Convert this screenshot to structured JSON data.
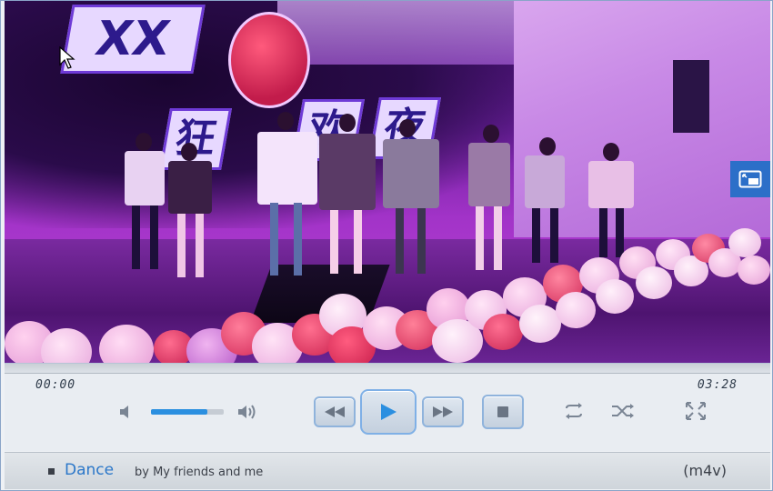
{
  "player": {
    "time_current": "00:00",
    "time_total": "03:28",
    "volume_level": 0.78,
    "progress": 0.0
  },
  "video": {
    "banner_text": "XX",
    "sign_chars": [
      "狂",
      "欢",
      "夜"
    ]
  },
  "track": {
    "title": "Dance",
    "by": "by My friends and me",
    "format": "(m4v)"
  },
  "icons": {
    "volume_low": "volume-low-icon",
    "volume_high": "volume-high-icon",
    "rewind": "rewind-icon",
    "play": "play-icon",
    "forward": "fast-forward-icon",
    "stop": "stop-icon",
    "repeat": "repeat-icon",
    "shuffle": "shuffle-icon",
    "fullscreen": "fullscreen-icon",
    "pip": "picture-in-picture-icon",
    "cursor": "mouse-cursor-icon"
  },
  "colors": {
    "accent": "#2b8fe0",
    "title_link": "#2b77c9",
    "pip_button": "#2c6fc8"
  }
}
